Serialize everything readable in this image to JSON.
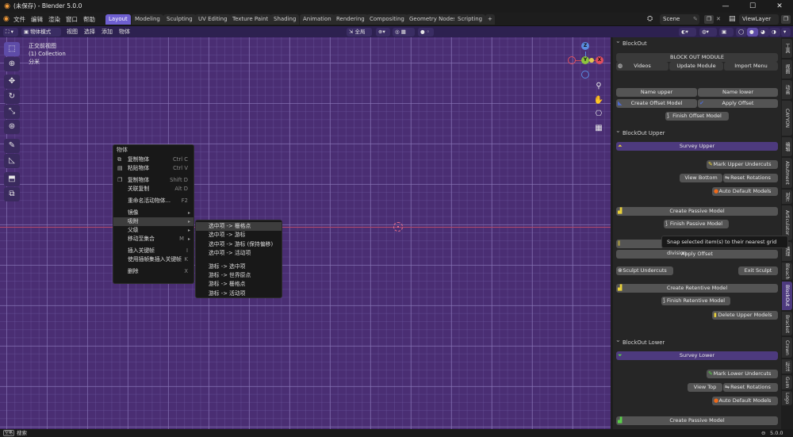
{
  "window": {
    "title": "(未保存) - Blender 5.0.0",
    "controls": [
      "—",
      "☐",
      "✕"
    ]
  },
  "menubar": {
    "items": [
      "文件",
      "编辑",
      "渲染",
      "窗口",
      "帮助"
    ],
    "workspaces": [
      "Layout",
      "Modeling",
      "Sculpting",
      "UV Editing",
      "Texture Paint",
      "Shading",
      "Animation",
      "Rendering",
      "Compositing",
      "Geometry Nodes",
      "Scripting"
    ],
    "add_tab": "+",
    "scene": "Scene",
    "view_layer": "ViewLayer"
  },
  "viewport_header": {
    "mode": "物体模式",
    "menus": [
      "视图",
      "选择",
      "添加",
      "物体"
    ],
    "transform": "全局"
  },
  "viewport": {
    "info": [
      "正交前视图",
      "(1) Collection",
      "分米"
    ],
    "gizmo": {
      "z": "Z",
      "y": "Y",
      "x": "X"
    }
  },
  "context_menu": {
    "title": "物体",
    "items": [
      {
        "icon": "⧉",
        "label": "复制物体",
        "shortcut": "Ctrl C"
      },
      {
        "icon": "▤",
        "label": "粘贴物体",
        "shortcut": "Ctrl V"
      },
      {
        "sep": true
      },
      {
        "icon": "❐",
        "label": "复制物体",
        "shortcut": "Shift D"
      },
      {
        "icon": "",
        "label": "关联复制",
        "shortcut": "Alt D"
      },
      {
        "sep": true
      },
      {
        "icon": "",
        "label": "重命名活动物体...",
        "shortcut": "F2"
      },
      {
        "sep": true
      },
      {
        "icon": "",
        "label": "镜像",
        "arrow": "▸"
      },
      {
        "icon": "",
        "label": "吸附",
        "arrow": "▸",
        "highlight": true
      },
      {
        "icon": "",
        "label": "父级",
        "arrow": "▸"
      },
      {
        "icon": "",
        "label": "移动至集合",
        "shortcut": "M",
        "arrow": "▸"
      },
      {
        "sep": true
      },
      {
        "icon": "",
        "label": "插入关键帧",
        "shortcut": "I"
      },
      {
        "icon": "",
        "label": "使用插帧集插入关键帧",
        "shortcut": "K"
      },
      {
        "sep": true
      },
      {
        "icon": "",
        "label": "删除",
        "shortcut": "X"
      }
    ]
  },
  "snap_menu": {
    "items": [
      {
        "label": "选中项 -> 栅格点",
        "highlight": true
      },
      {
        "label": "选中项 -> 游标"
      },
      {
        "label": "选中项 -> 游标 (保持偏移)"
      },
      {
        "label": "选中项 -> 活动项"
      },
      {
        "sep": true
      },
      {
        "label": "游标 -> 选中项"
      },
      {
        "label": "游标 -> 世界原点"
      },
      {
        "label": "游标 -> 栅格点"
      },
      {
        "label": "游标 -> 活动项"
      }
    ]
  },
  "tooltip": "Snap selected item(s) to their nearest grid division.",
  "panel": {
    "blockout": {
      "header": "BlockOut",
      "module_btn": "BLOCK OUT MODULE",
      "videos": "Videos",
      "update": "Update Module",
      "import": "Import Menu",
      "name_upper": "Name upper",
      "name_lower": "Name lower",
      "create_offset": "Create Offset Model",
      "apply_offset": "Apply Offset",
      "finish_offset": "Finish Offset Model"
    },
    "upper": {
      "header": "BlockOut Upper",
      "survey": "Survey Upper",
      "mark": "Mark Upper Undercuts",
      "view_bottom": "View Bottom",
      "reset_rot": "Reset Rotations",
      "auto_default": "Auto Default Models",
      "create_passive": "Create Passive Model",
      "finish_passive": "Finish Passive Model",
      "apply_offset": "Apply Offset",
      "sculpt": "Sculpt Undercuts",
      "exit_sculpt": "Exit Sculpt",
      "create_retentive": "Create Retentive Model",
      "finish_retentive": "Finish Retentive Model",
      "delete": "Delete Upper Models"
    },
    "lower": {
      "header": "BlockOut Lower",
      "survey": "Survey Lower",
      "mark": "Mark Lower Undercuts",
      "view_top": "View Top",
      "reset_rot": "Reset Rotations",
      "auto_default": "Auto Default Models",
      "create_passive": "Create Passive Model"
    }
  },
  "sidebar_tabs": [
    "工具",
    "视图",
    "动画",
    "CAYYON",
    "编辑",
    "Abutment",
    "对齐",
    "Articulator",
    "清理",
    "Bleach",
    "BlockOut",
    "Bracket",
    "Crown",
    "标注",
    "Gum",
    "Logo"
  ],
  "statusbar": {
    "left": "空格",
    "search": "搜索",
    "version": "5.0.0"
  }
}
